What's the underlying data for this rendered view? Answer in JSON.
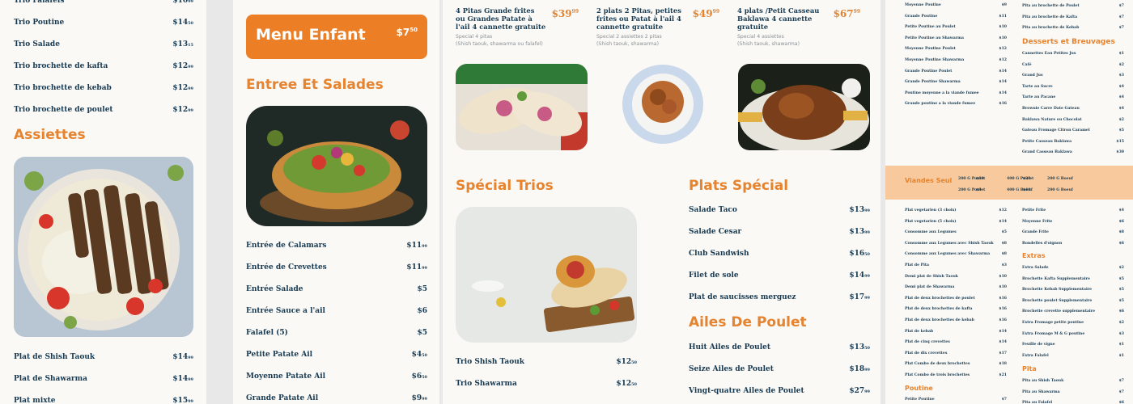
{
  "p1": {
    "items_top": [
      {
        "name": "Trio Falafels",
        "price": "$10",
        "cents": "99"
      },
      {
        "name": "Trio Poutine",
        "price": "$14",
        "cents": "50"
      },
      {
        "name": "Trio Salade",
        "price": "$13",
        "cents": "15"
      },
      {
        "name": "Trio brochette de kafta",
        "price": "$12",
        "cents": "99"
      },
      {
        "name": "Trio brochette de kebab",
        "price": "$12",
        "cents": "99"
      },
      {
        "name": "Trio brochette de poulet",
        "price": "$12",
        "cents": "99"
      }
    ],
    "heading": "Assiettes",
    "items_bottom": [
      {
        "name": "Plat de Shish Taouk",
        "price": "$14",
        "cents": "99"
      },
      {
        "name": "Plat de Shawarma",
        "price": "$14",
        "cents": "99"
      },
      {
        "name": "Plat mixte",
        "price": "$15",
        "cents": "99"
      }
    ]
  },
  "p2": {
    "banner_title": "Menu Enfant",
    "banner_price": "$7",
    "banner_cents": "50",
    "heading": "Entree Et Salades",
    "items": [
      {
        "name": "Entrée de Calamars",
        "price": "$11",
        "cents": "99"
      },
      {
        "name": "Entrée de Crevettes",
        "price": "$11",
        "cents": "99"
      },
      {
        "name": "Entrée Salade",
        "price": "$5",
        "cents": ""
      },
      {
        "name": "Entrée Sauce a l'ail",
        "price": "$6",
        "cents": ""
      },
      {
        "name": "Falafel (5)",
        "price": "$5",
        "cents": ""
      },
      {
        "name": "Petite Patate Ail",
        "price": "$4",
        "cents": "50"
      },
      {
        "name": "Moyenne Patate Ail",
        "price": "$6",
        "cents": "50"
      },
      {
        "name": "Grande Patate Ail",
        "price": "$9",
        "cents": "99"
      }
    ]
  },
  "p3": {
    "combos": [
      {
        "title": "4 Pitas Grande frites ou Grandes Patate à l'ail 4 cannette gratuite",
        "price": "$39",
        "cents": "99",
        "sub1": "Special 4 pitas",
        "sub2": "(Shish taouk, shawarma ou falafel)"
      },
      {
        "title": "2 plats 2 Pitas, petites frites ou Patat à l'ail 4 cannette gratuite",
        "price": "$49",
        "cents": "99",
        "sub1": "Special 2 assiettes 2 pitas",
        "sub2": "(Shish taouk, shawarma)"
      },
      {
        "title": "4 plats /Petit Casseau Baklawa 4 cannette gratuite",
        "price": "$67",
        "cents": "99",
        "sub1": "Special 4 assiettes",
        "sub2": "(Shish taouk, shawarma)"
      }
    ],
    "trios_heading": "Spécial Trios",
    "trios": [
      {
        "name": "Trio Shish Taouk",
        "price": "$12",
        "cents": "50"
      },
      {
        "name": "Trio Shawarma",
        "price": "$12",
        "cents": "50"
      }
    ],
    "plats_heading": "Plats Spécial",
    "plats": [
      {
        "name": "Salade Taco",
        "price": "$13",
        "cents": "99"
      },
      {
        "name": "Salade Cesar",
        "price": "$13",
        "cents": "99"
      },
      {
        "name": "Club Sandwish",
        "price": "$16",
        "cents": "50"
      },
      {
        "name": "Filet de sole",
        "price": "$14",
        "cents": "99"
      },
      {
        "name": "Plat de saucisses merguez",
        "price": "$17",
        "cents": "99"
      }
    ],
    "ailes_heading": "Ailes De Poulet",
    "ailes": [
      {
        "name": "Huit Ailes de Poulet",
        "price": "$13",
        "cents": "50"
      },
      {
        "name": "Seize Ailes de Poulet",
        "price": "$18",
        "cents": "99"
      },
      {
        "name": "Vingt-quatre Ailes de Poulet",
        "price": "$27",
        "cents": "99"
      }
    ]
  },
  "p4": {
    "left_top": [
      {
        "name": "Moyenne Poutine",
        "price": "$9"
      },
      {
        "name": "Grande Poutine",
        "price": "$11"
      },
      {
        "name": "Petite Poutine au Poulet",
        "price": "$10"
      },
      {
        "name": "Petite Poutine au Shawarma",
        "price": "$10"
      },
      {
        "name": "Moyenne Poutine Poulet",
        "price": "$12"
      },
      {
        "name": "Moyenne Poutine Shawarma",
        "price": "$12"
      },
      {
        "name": "Grande Poutine Poulet",
        "price": "$14"
      },
      {
        "name": "Grande Poutine Shawarma",
        "price": "$14"
      },
      {
        "name": "Poutine moyenne a la viande fumee",
        "price": "$14"
      },
      {
        "name": "Grande poutine a la viande fumee",
        "price": "$16"
      }
    ],
    "right_top": [
      {
        "name": "Pita au brochette de Poulet",
        "price": "$7"
      },
      {
        "name": "Pita au brochette de Kafta",
        "price": "$7"
      },
      {
        "name": "Pita au brochette de Kebab",
        "price": "$7"
      }
    ],
    "desserts_heading": "Desserts et Breuvages",
    "desserts": [
      {
        "name": "Cannettes Eau Petites Jus",
        "price": "$1"
      },
      {
        "name": "Café",
        "price": "$2"
      },
      {
        "name": "Grand Jus",
        "price": "$3"
      },
      {
        "name": "Tarte au Sucre",
        "price": "$4"
      },
      {
        "name": "Tarte au Pacane",
        "price": "$4"
      },
      {
        "name": "Brownie Carre Date Gateau",
        "price": "$4"
      },
      {
        "name": "Baklawa Nature ou Chocolat",
        "price": "$2"
      },
      {
        "name": "Gateau Fromage Citron Caramel",
        "price": "$5"
      },
      {
        "name": "Petite Casseau Baklawa",
        "price": "$15"
      },
      {
        "name": "Grand Casseau Baklawa",
        "price": "$30"
      }
    ],
    "band_heading": "Viandes Seul",
    "band_items": [
      "200 G Poulet",
      "$10",
      "400 G Poulet",
      "$20",
      "200 G Boeuf",
      "200 G Poulet",
      "$9",
      "400 G Boeuf",
      "$18",
      "200 G Boeuf"
    ],
    "left_bottom": [
      {
        "name": "Plat vegetarien (3 choix)",
        "price": "$12"
      },
      {
        "name": "Plat vegetarien (5 choix)",
        "price": "$14"
      },
      {
        "name": "Consomme aux Legumes",
        "price": "$5"
      },
      {
        "name": "Consomme aux Legumes avec Shish Taouk",
        "price": "$8"
      },
      {
        "name": "Consomme aux Legumes avec Shawarma",
        "price": "$8"
      },
      {
        "name": "Plat de Pita",
        "price": "$3"
      },
      {
        "name": "Demi plat de Shish Taouk",
        "price": "$10"
      },
      {
        "name": "Demi plat de Shawarma",
        "price": "$10"
      },
      {
        "name": "Plat de deux brochettes de poulet",
        "price": "$16"
      },
      {
        "name": "Plat de deux brochettes de kafta",
        "price": "$16"
      },
      {
        "name": "Plat de deux brochettes de kebab",
        "price": "$16"
      },
      {
        "name": "Plat de kebab",
        "price": "$14"
      },
      {
        "name": "Plat de cinq crevettes",
        "price": "$14"
      },
      {
        "name": "Plat de dix crevettes",
        "price": "$17"
      },
      {
        "name": "Plat Combo de deux brochettes",
        "price": "$18"
      },
      {
        "name": "Plat Combo de trois brochettes",
        "price": "$21"
      }
    ],
    "poutine_heading": "Poutine",
    "poutine": [
      {
        "name": "Petite Poutine",
        "price": "$7"
      }
    ],
    "right_bottom": [
      {
        "name": "Petite Frite",
        "price": "$4"
      },
      {
        "name": "Moyenne Frite",
        "price": "$6"
      },
      {
        "name": "Grande Frite",
        "price": "$8"
      },
      {
        "name": "Rondelles d'oignon",
        "price": "$6"
      }
    ],
    "extras_heading": "Extras",
    "extras": [
      {
        "name": "Extra Salade",
        "price": "$2"
      },
      {
        "name": "Brochette Kafta Supplementaire",
        "price": "$5"
      },
      {
        "name": "Brochette Kebab Supplementaire",
        "price": "$5"
      },
      {
        "name": "Brochette poulet Supplementaire",
        "price": "$5"
      },
      {
        "name": "Brochette crevette supplementaire",
        "price": "$6"
      },
      {
        "name": "Extra Fromage petite poutine",
        "price": "$2"
      },
      {
        "name": "Extra Fromage M & G poutine",
        "price": "$3"
      },
      {
        "name": "Feuille de vigne",
        "price": "$1"
      },
      {
        "name": "Extra Falafel",
        "price": "$1"
      }
    ],
    "pita_heading": "Pita",
    "pita": [
      {
        "name": "Pita au Shish Taouk",
        "price": "$7"
      },
      {
        "name": "Pita au Shawarma",
        "price": "$7"
      },
      {
        "name": "Pita au Falafel",
        "price": "$6"
      }
    ]
  }
}
